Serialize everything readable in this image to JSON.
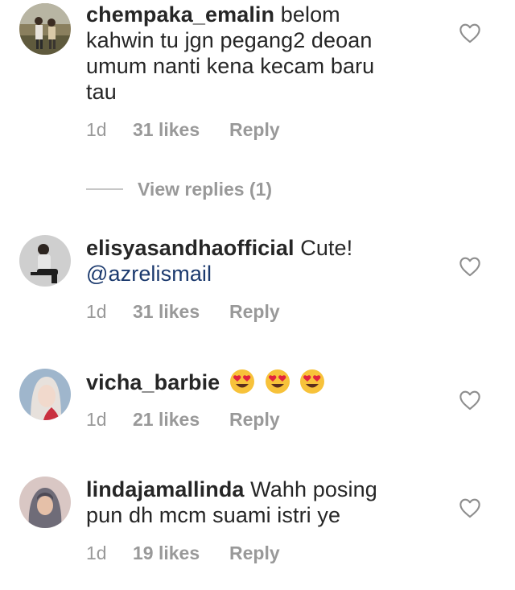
{
  "comments": [
    {
      "username": "chempaka_emalin",
      "text_lines": [
        "belom",
        "kahwin tu jgn pegang2 deoan",
        "umum nanti kena kecam baru",
        "tau"
      ],
      "time": "1d",
      "likes": "31 likes",
      "reply_label": "Reply",
      "view_replies": "View replies (1)",
      "avatar_icon": "outdoor-photo-avatar"
    },
    {
      "username": "elisyasandhaofficial",
      "text": "Cute!",
      "mention": "@azrelismail",
      "time": "1d",
      "likes": "31 likes",
      "reply_label": "Reply",
      "avatar_icon": "woman-sitting-avatar"
    },
    {
      "username": "vicha_barbie",
      "emojis": [
        "heart-eyes-emoji",
        "heart-eyes-emoji",
        "heart-eyes-emoji"
      ],
      "time": "1d",
      "likes": "21 likes",
      "reply_label": "Reply",
      "avatar_icon": "woman-portrait-avatar"
    },
    {
      "username": "lindajamallinda",
      "text_lines": [
        "Wahh posing",
        "pun dh mcm suami istri ye"
      ],
      "time": "1d",
      "likes": "19 likes",
      "reply_label": "Reply",
      "avatar_icon": "hijab-woman-avatar"
    }
  ],
  "icons": {
    "like": "heart-outline-icon"
  },
  "colors": {
    "text": "#262626",
    "meta": "#999999",
    "mention": "#1c3a6e",
    "divider": "#c7c7c7"
  }
}
